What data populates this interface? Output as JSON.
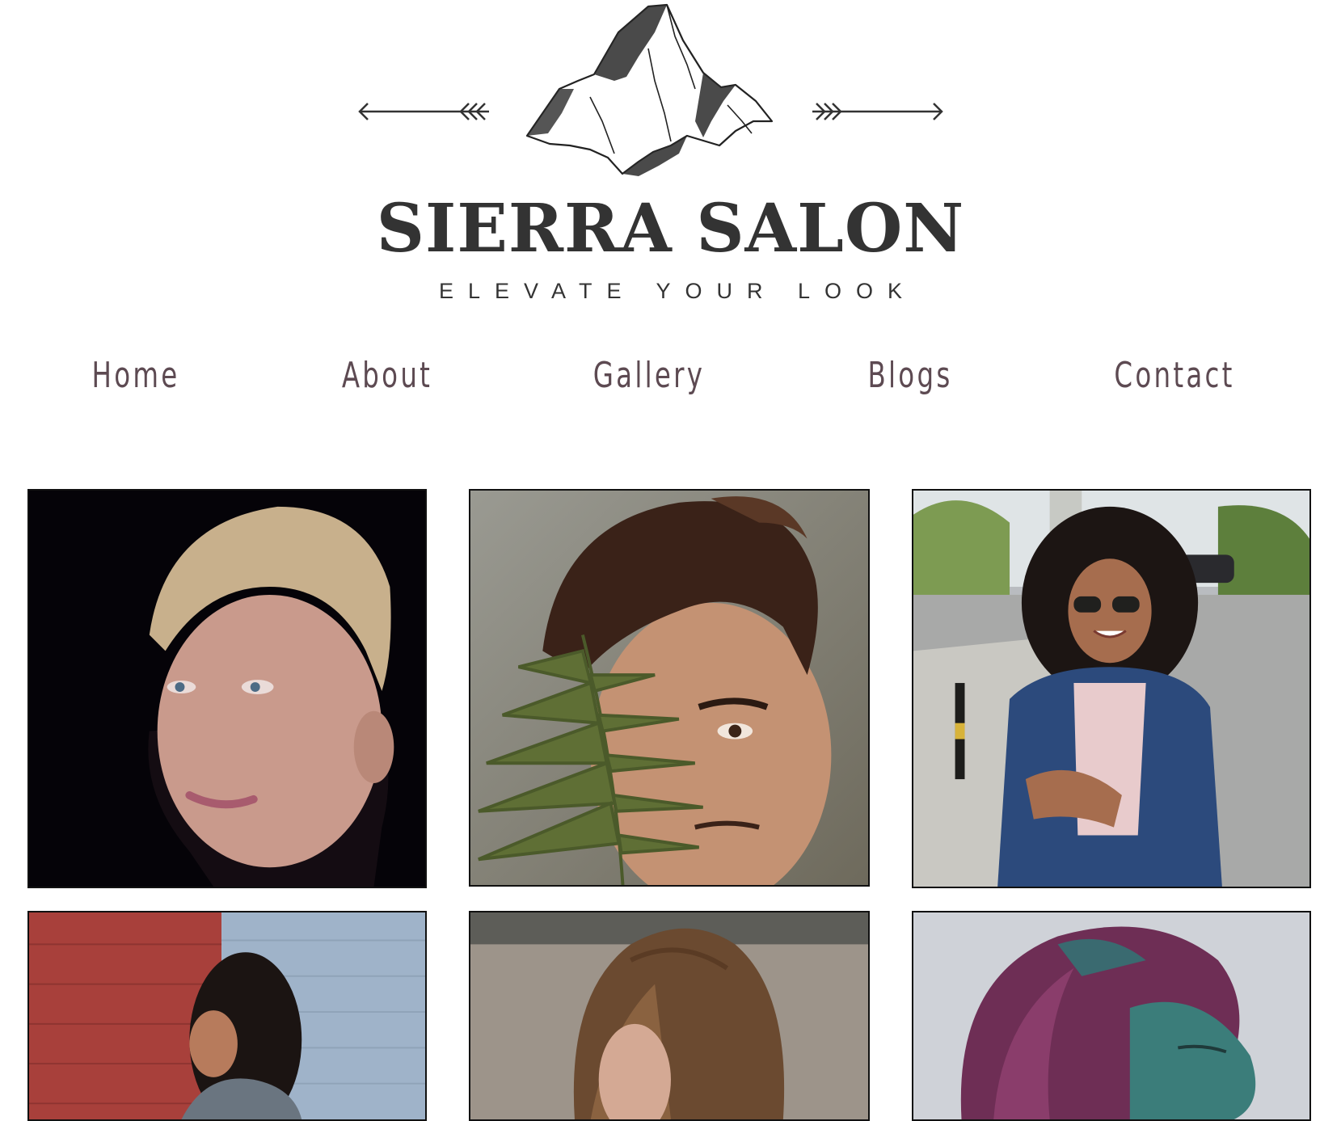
{
  "brand": {
    "name": "SIERRA SALON",
    "tagline": "ELEVATE YOUR LOOK",
    "logo_icon": "mountain-logo-with-arrows"
  },
  "nav": {
    "items": [
      {
        "label": "Home"
      },
      {
        "label": "About"
      },
      {
        "label": "Gallery"
      },
      {
        "label": "Blogs"
      },
      {
        "label": "Contact"
      }
    ]
  },
  "colors": {
    "nav_text": "#5d4a52",
    "brand_text": "#333333",
    "tile_border": "#111111"
  },
  "gallery": {
    "tiles": [
      {
        "subject": "woman-short-blonde-pixie-cut"
      },
      {
        "subject": "man-holding-fern-leaf"
      },
      {
        "subject": "woman-curly-hair-denim-jacket-sunglasses"
      },
      {
        "subject": "woman-curly-hair-brick-wall"
      },
      {
        "subject": "woman-long-brown-hair"
      },
      {
        "subject": "woman-purple-dyed-hair"
      }
    ]
  }
}
